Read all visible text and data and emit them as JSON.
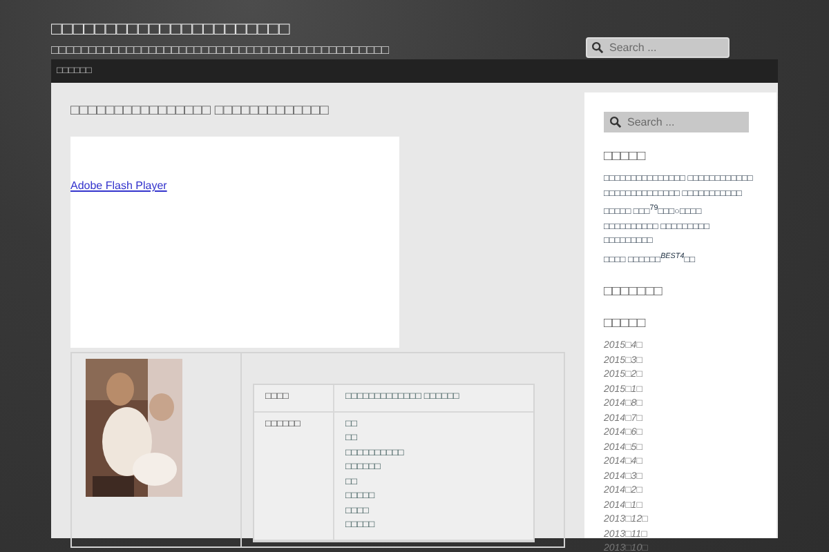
{
  "site": {
    "title": "□□□□□□□□□□□□□□□□□□□□□□",
    "tagline": "□□□□□□□□□□□□□□□□□□□□□□□□□□□□□□□□□□□□□□□□□□□□□"
  },
  "search": {
    "placeholder": "Search ..."
  },
  "nav": [
    {
      "label": "□□□□□□"
    }
  ],
  "article": {
    "title": "□□□□□□□□□□□□□□□□ □□□□□□□□□□□□□",
    "flash_link": "Adobe Flash Player",
    "details": [
      {
        "label": "□□□□",
        "values": [
          "□□□□□□□□□□□□□ □□□□□□"
        ]
      },
      {
        "label": "□□□□□□",
        "values": [
          "□□",
          "□□",
          "□□□□□□□□□□",
          "□□□□□□",
          "□□",
          "□□□□□",
          "□□□□",
          "□□□□□"
        ]
      }
    ]
  },
  "sidebar": {
    "search": {
      "placeholder": "Search ..."
    },
    "sections": [
      {
        "kind": "text",
        "heading": "□□□□□",
        "paragraphs": [
          "□□□□□□□□□□□□□□□ □□□□□□□□□□□□ □□□□□□□□□□□□□□ □□□□□□□□□□□ □□□□□ □□□$^{79}$□□□○□□□□ □□□□□□□□□□ □□□□□□□□□ □□□□□□□□□",
          "□□□□ □□□□□□*$^{BEST4}$*□□"
        ]
      },
      {
        "kind": "heading",
        "heading": "□□□□□□□"
      },
      {
        "kind": "links",
        "heading": "□□□□□",
        "items": [
          "2015□4□",
          "2015□3□",
          "2015□2□",
          "2015□1□",
          "2014□8□",
          "2014□7□",
          "2014□6□",
          "2014□5□",
          "2014□4□",
          "2014□3□",
          "2014□2□",
          "2014□1□",
          "2013□12□",
          "2013□11□",
          "2013□10□"
        ]
      }
    ]
  }
}
